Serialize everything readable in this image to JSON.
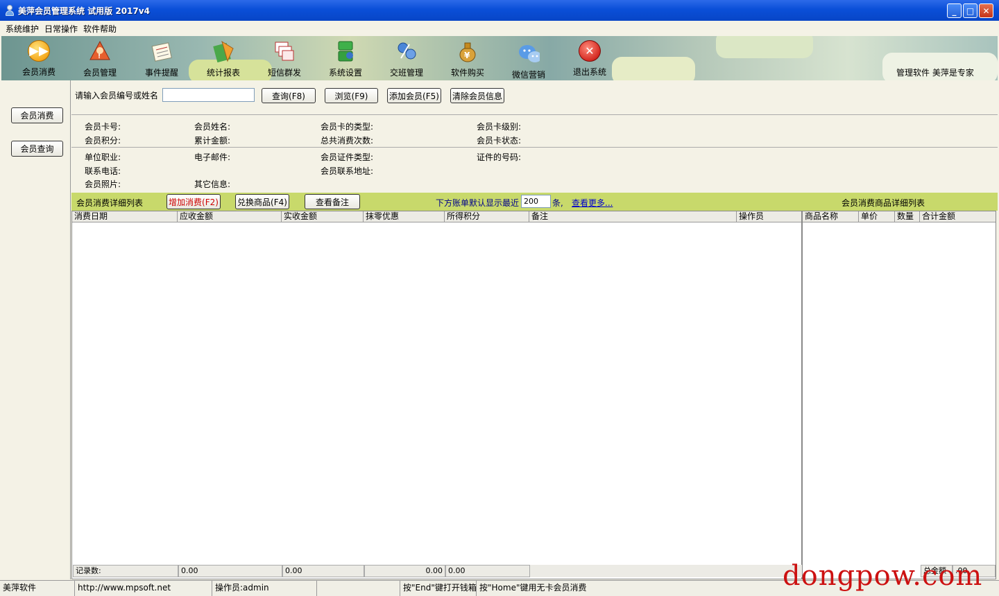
{
  "window": {
    "title": "美萍会员管理系统 试用版  2017v4",
    "min": "_",
    "max": "□",
    "close": "✕"
  },
  "menu": [
    "系统维护",
    "日常操作",
    "软件帮助"
  ],
  "toolbar": {
    "items": [
      {
        "label": "会员消费",
        "icon": "fast-forward-icon",
        "color": "#f5a81c"
      },
      {
        "label": "会员管理",
        "icon": "members-icon",
        "color": "#d94a2a"
      },
      {
        "label": "事件提醒",
        "icon": "calendar-icon",
        "color": "#e8e0c8"
      },
      {
        "label": "统计报表",
        "icon": "report-icon",
        "color": "#e69a22"
      },
      {
        "label": "短信群发",
        "icon": "sms-icon",
        "color": "#d8524a"
      },
      {
        "label": "系统设置",
        "icon": "settings-icon",
        "color": "#34a03a"
      },
      {
        "label": "交班管理",
        "icon": "shift-icon",
        "color": "#3a74c8"
      },
      {
        "label": "软件购买",
        "icon": "money-bag-icon",
        "color": "#c98a1e"
      },
      {
        "label": "微信营销",
        "icon": "wechat-icon",
        "color": "#4a8ee0"
      },
      {
        "label": "退出系统",
        "icon": "exit-icon",
        "color": "#d42a22"
      }
    ],
    "note": "管理软件  美萍是专家"
  },
  "left": {
    "consume_btn": "会员消费",
    "query_btn": "会员查询"
  },
  "search": {
    "label": "请输入会员编号或姓名",
    "value": "",
    "query_btn": "查询(F8)",
    "browse_btn": "浏览(F9)",
    "add_btn": "添加会员(F5)",
    "clear_btn": "清除会员信息"
  },
  "info": {
    "card_no": "会员卡号:",
    "name": "会员姓名:",
    "card_type": "会员卡的类型:",
    "card_level": "会员卡级别:",
    "points": "会员积分:",
    "total_amount": "累计金额:",
    "total_times": "总共消费次数:",
    "card_status": "会员卡状态:",
    "job": "单位职业:",
    "email": "电子邮件:",
    "id_type": "会员证件类型:",
    "id_no": "证件的号码:",
    "phone": "联系电话:",
    "address": "会员联系地址:",
    "photo": "会员照片:",
    "other": "其它信息:"
  },
  "list_bar": {
    "title": "会员消费详细列表",
    "add_btn": "增加消费(F2)",
    "exchange_btn": "兑换商品(F4)",
    "remark_btn": "查看备注",
    "default_prefix": "下方账单默认显示最近",
    "default_count": "200",
    "default_suffix": "条,",
    "more_link": "查看更多...",
    "right_title": "会员消费商品详细列表"
  },
  "main_table": {
    "columns": [
      "消费日期",
      "应收金额",
      "实收金额",
      "抹零优惠",
      "所得积分",
      "备注",
      "操作员"
    ],
    "footer": [
      "记录数:",
      "0.00",
      "0.00",
      "0.00",
      "0.00"
    ]
  },
  "goods_table": {
    "columns": [
      "商品名称",
      "单价",
      "数量",
      "合计金额"
    ],
    "footer_label": "总金额",
    "footer_value": ".00"
  },
  "status": [
    "美萍软件",
    "http://www.mpsoft.net",
    "操作员:admin",
    "",
    "按\"End\"键打开钱箱",
    "按\"Home\"键用无卡会员消费"
  ],
  "watermark": "dongpow.com"
}
